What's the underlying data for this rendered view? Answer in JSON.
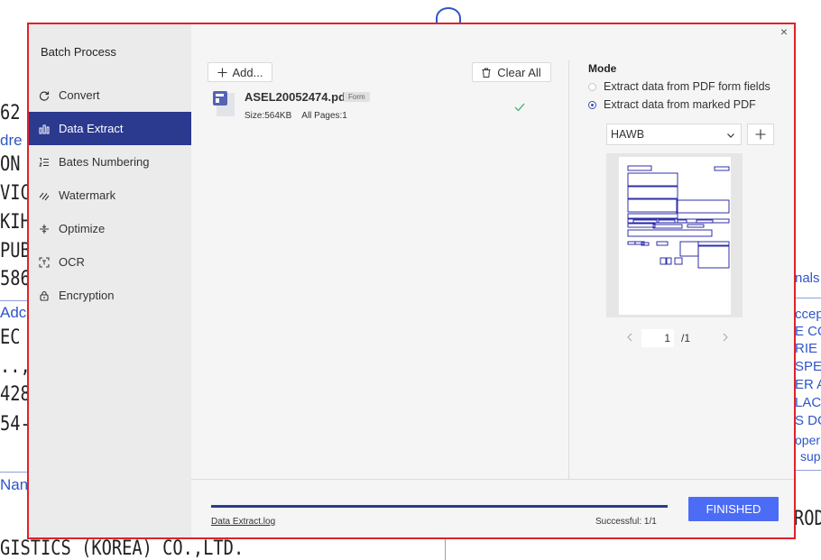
{
  "background_document": {
    "left_lines": [
      "62",
      "dre",
      "ON",
      "VIC",
      "KIH",
      "PUB",
      "586",
      "Adc",
      "EC",
      "..,",
      "428",
      "54-",
      "Nan",
      "GISTICS (KOREA) CO.,LTD."
    ],
    "right_lines": [
      "nals",
      "ccep",
      "E CO",
      "RIE",
      "SPE",
      "ER A",
      "LAC",
      "S DO",
      "oper",
      "sup",
      "ROD"
    ]
  },
  "dialog": {
    "title": "Batch Process",
    "close_symbol": "×",
    "sidebar_items": [
      {
        "label": "Convert",
        "icon": "refresh-icon",
        "active": false
      },
      {
        "label": "Data Extract",
        "icon": "bar-chart-icon",
        "active": true
      },
      {
        "label": "Bates Numbering",
        "icon": "numbered-list-icon",
        "active": false
      },
      {
        "label": "Watermark",
        "icon": "watermark-icon",
        "active": false
      },
      {
        "label": "Optimize",
        "icon": "optimize-icon",
        "active": false
      },
      {
        "label": "OCR",
        "icon": "ocr-icon",
        "active": false
      },
      {
        "label": "Encryption",
        "icon": "lock-icon",
        "active": false
      }
    ],
    "toolbar": {
      "add_label": "Add...",
      "clear_label": "Clear All"
    },
    "files": [
      {
        "name": "ASEL20052474.pdf",
        "tag": "Form",
        "size_text": "Size:564KB",
        "pages_text": "All Pages:1",
        "status": "done"
      }
    ],
    "mode_panel": {
      "label": "Mode",
      "options": [
        {
          "label": "Extract data from PDF form fields",
          "selected": false
        },
        {
          "label": "Extract data from marked PDF",
          "selected": true
        }
      ],
      "template_select": "HAWB",
      "current_page": "1",
      "total_pages": "/1"
    },
    "footer": {
      "log_link": "Data Extract.log",
      "status_text": "Successful: 1/1",
      "finish_label": "FINISHED",
      "progress": 1.0
    },
    "colors": {
      "accent": "#2b3a8f",
      "finish_button": "#4c6cf6",
      "dialog_border": "#e0222a",
      "check": "#3aa66a"
    }
  }
}
